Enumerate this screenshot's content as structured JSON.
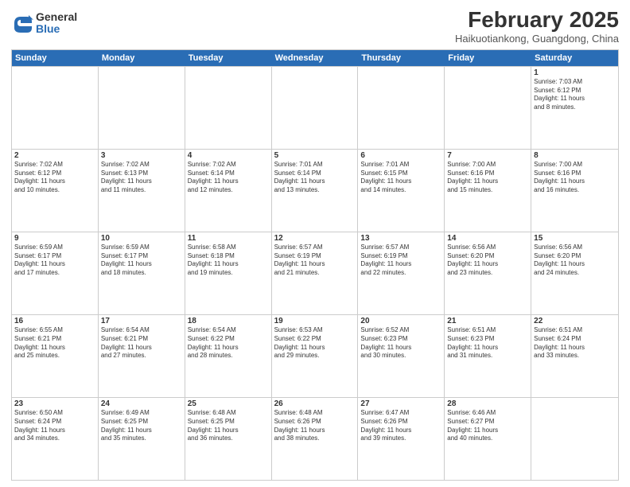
{
  "header": {
    "logo_general": "General",
    "logo_blue": "Blue",
    "month_year": "February 2025",
    "location": "Haikuotiankong, Guangdong, China"
  },
  "weekdays": [
    "Sunday",
    "Monday",
    "Tuesday",
    "Wednesday",
    "Thursday",
    "Friday",
    "Saturday"
  ],
  "rows": [
    [
      {
        "day": "",
        "info": ""
      },
      {
        "day": "",
        "info": ""
      },
      {
        "day": "",
        "info": ""
      },
      {
        "day": "",
        "info": ""
      },
      {
        "day": "",
        "info": ""
      },
      {
        "day": "",
        "info": ""
      },
      {
        "day": "1",
        "info": "Sunrise: 7:03 AM\nSunset: 6:12 PM\nDaylight: 11 hours\nand 8 minutes."
      }
    ],
    [
      {
        "day": "2",
        "info": "Sunrise: 7:02 AM\nSunset: 6:12 PM\nDaylight: 11 hours\nand 10 minutes."
      },
      {
        "day": "3",
        "info": "Sunrise: 7:02 AM\nSunset: 6:13 PM\nDaylight: 11 hours\nand 11 minutes."
      },
      {
        "day": "4",
        "info": "Sunrise: 7:02 AM\nSunset: 6:14 PM\nDaylight: 11 hours\nand 12 minutes."
      },
      {
        "day": "5",
        "info": "Sunrise: 7:01 AM\nSunset: 6:14 PM\nDaylight: 11 hours\nand 13 minutes."
      },
      {
        "day": "6",
        "info": "Sunrise: 7:01 AM\nSunset: 6:15 PM\nDaylight: 11 hours\nand 14 minutes."
      },
      {
        "day": "7",
        "info": "Sunrise: 7:00 AM\nSunset: 6:16 PM\nDaylight: 11 hours\nand 15 minutes."
      },
      {
        "day": "8",
        "info": "Sunrise: 7:00 AM\nSunset: 6:16 PM\nDaylight: 11 hours\nand 16 minutes."
      }
    ],
    [
      {
        "day": "9",
        "info": "Sunrise: 6:59 AM\nSunset: 6:17 PM\nDaylight: 11 hours\nand 17 minutes."
      },
      {
        "day": "10",
        "info": "Sunrise: 6:59 AM\nSunset: 6:17 PM\nDaylight: 11 hours\nand 18 minutes."
      },
      {
        "day": "11",
        "info": "Sunrise: 6:58 AM\nSunset: 6:18 PM\nDaylight: 11 hours\nand 19 minutes."
      },
      {
        "day": "12",
        "info": "Sunrise: 6:57 AM\nSunset: 6:19 PM\nDaylight: 11 hours\nand 21 minutes."
      },
      {
        "day": "13",
        "info": "Sunrise: 6:57 AM\nSunset: 6:19 PM\nDaylight: 11 hours\nand 22 minutes."
      },
      {
        "day": "14",
        "info": "Sunrise: 6:56 AM\nSunset: 6:20 PM\nDaylight: 11 hours\nand 23 minutes."
      },
      {
        "day": "15",
        "info": "Sunrise: 6:56 AM\nSunset: 6:20 PM\nDaylight: 11 hours\nand 24 minutes."
      }
    ],
    [
      {
        "day": "16",
        "info": "Sunrise: 6:55 AM\nSunset: 6:21 PM\nDaylight: 11 hours\nand 25 minutes."
      },
      {
        "day": "17",
        "info": "Sunrise: 6:54 AM\nSunset: 6:21 PM\nDaylight: 11 hours\nand 27 minutes."
      },
      {
        "day": "18",
        "info": "Sunrise: 6:54 AM\nSunset: 6:22 PM\nDaylight: 11 hours\nand 28 minutes."
      },
      {
        "day": "19",
        "info": "Sunrise: 6:53 AM\nSunset: 6:22 PM\nDaylight: 11 hours\nand 29 minutes."
      },
      {
        "day": "20",
        "info": "Sunrise: 6:52 AM\nSunset: 6:23 PM\nDaylight: 11 hours\nand 30 minutes."
      },
      {
        "day": "21",
        "info": "Sunrise: 6:51 AM\nSunset: 6:23 PM\nDaylight: 11 hours\nand 31 minutes."
      },
      {
        "day": "22",
        "info": "Sunrise: 6:51 AM\nSunset: 6:24 PM\nDaylight: 11 hours\nand 33 minutes."
      }
    ],
    [
      {
        "day": "23",
        "info": "Sunrise: 6:50 AM\nSunset: 6:24 PM\nDaylight: 11 hours\nand 34 minutes."
      },
      {
        "day": "24",
        "info": "Sunrise: 6:49 AM\nSunset: 6:25 PM\nDaylight: 11 hours\nand 35 minutes."
      },
      {
        "day": "25",
        "info": "Sunrise: 6:48 AM\nSunset: 6:25 PM\nDaylight: 11 hours\nand 36 minutes."
      },
      {
        "day": "26",
        "info": "Sunrise: 6:48 AM\nSunset: 6:26 PM\nDaylight: 11 hours\nand 38 minutes."
      },
      {
        "day": "27",
        "info": "Sunrise: 6:47 AM\nSunset: 6:26 PM\nDaylight: 11 hours\nand 39 minutes."
      },
      {
        "day": "28",
        "info": "Sunrise: 6:46 AM\nSunset: 6:27 PM\nDaylight: 11 hours\nand 40 minutes."
      },
      {
        "day": "",
        "info": ""
      }
    ]
  ]
}
